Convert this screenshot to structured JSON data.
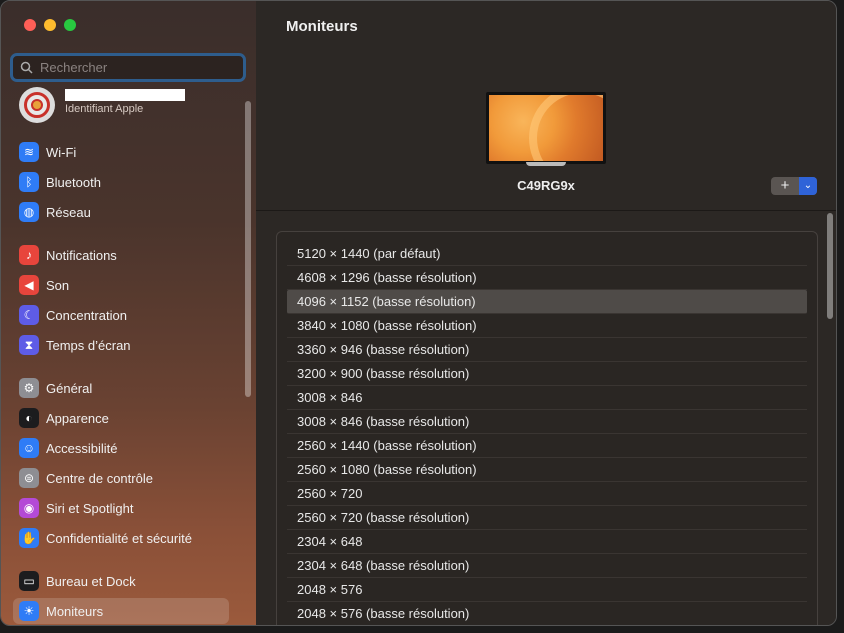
{
  "window": {
    "title": "Moniteurs"
  },
  "search": {
    "placeholder": "Rechercher"
  },
  "account": {
    "subtitle": "Identifiant Apple"
  },
  "sidebar": {
    "items": [
      {
        "label": "Wi-Fi",
        "icon": "wifi-icon",
        "color": "#2f7cf6"
      },
      {
        "label": "Bluetooth",
        "icon": "bluetooth-icon",
        "color": "#2f7cf6"
      },
      {
        "label": "Réseau",
        "icon": "globe-icon",
        "color": "#2f7cf6"
      },
      {
        "label": "Notifications",
        "icon": "bell-icon",
        "color": "#e8453c"
      },
      {
        "label": "Son",
        "icon": "speaker-icon",
        "color": "#e8453c"
      },
      {
        "label": "Concentration",
        "icon": "moon-icon",
        "color": "#5e5ce6"
      },
      {
        "label": "Temps d’écran",
        "icon": "hourglass-icon",
        "color": "#5e5ce6"
      },
      {
        "label": "Général",
        "icon": "gear-icon",
        "color": "#8e8e93"
      },
      {
        "label": "Apparence",
        "icon": "appearance-icon",
        "color": "#1c1c1e"
      },
      {
        "label": "Accessibilité",
        "icon": "accessibility-icon",
        "color": "#2f7cf6"
      },
      {
        "label": "Centre de contrôle",
        "icon": "toggles-icon",
        "color": "#8e8e93"
      },
      {
        "label": "Siri et Spotlight",
        "icon": "siri-icon",
        "color": "#b44ad6"
      },
      {
        "label": "Confidentialité et sécurité",
        "icon": "hand-icon",
        "color": "#2f7cf6"
      },
      {
        "label": "Bureau et Dock",
        "icon": "dock-icon",
        "color": "#1c1c1e"
      },
      {
        "label": "Moniteurs",
        "icon": "sun-icon",
        "color": "#2f7cf6",
        "selected": true
      }
    ]
  },
  "display": {
    "name": "C49RG9x",
    "add_label": "+",
    "menu_label": "⌄"
  },
  "resolutions": [
    {
      "label": "5120 × 1440 (par défaut)"
    },
    {
      "label": "4608 × 1296 (basse résolution)"
    },
    {
      "label": "4096 × 1152 (basse résolution)",
      "selected": true
    },
    {
      "label": "3840 × 1080 (basse résolution)"
    },
    {
      "label": "3360 × 946 (basse résolution)"
    },
    {
      "label": "3200 × 900 (basse résolution)"
    },
    {
      "label": "3008 × 846"
    },
    {
      "label": "3008 × 846 (basse résolution)"
    },
    {
      "label": "2560 × 1440 (basse résolution)"
    },
    {
      "label": "2560 × 1080 (basse résolution)"
    },
    {
      "label": "2560 × 720"
    },
    {
      "label": "2560 × 720 (basse résolution)"
    },
    {
      "label": "2304 × 648"
    },
    {
      "label": "2304 × 648 (basse résolution)"
    },
    {
      "label": "2048 × 576"
    },
    {
      "label": "2048 × 576 (basse résolution)"
    }
  ]
}
